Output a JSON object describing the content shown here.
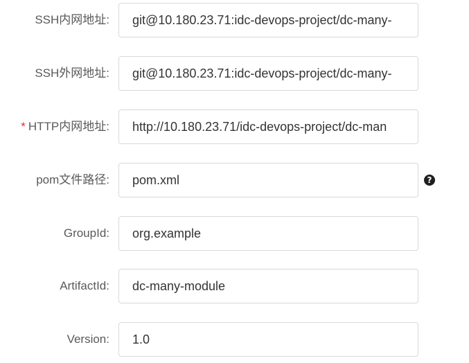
{
  "form": {
    "fields": [
      {
        "label": "SSH内网地址:",
        "value": "git@10.180.23.71:idc-devops-project/dc-many-",
        "required": false
      },
      {
        "label": "SSH外网地址:",
        "value": "git@10.180.23.71:idc-devops-project/dc-many-",
        "required": false
      },
      {
        "label": "HTTP内网地址:",
        "value": "http://10.180.23.71/idc-devops-project/dc-man",
        "required": true,
        "required_mark": "*"
      },
      {
        "label": "pom文件路径:",
        "value": "pom.xml",
        "required": false,
        "help_icon": "question-circle-icon",
        "help_glyph": "?"
      },
      {
        "label": "GroupId:",
        "value": "org.example",
        "required": false
      },
      {
        "label": "ArtifactId:",
        "value": "dc-many-module",
        "required": false
      },
      {
        "label": "Version:",
        "value": "1.0",
        "required": false
      }
    ]
  },
  "colors": {
    "label": "#595959",
    "input_text": "#333333",
    "input_border": "#d9d9d9",
    "required": "#f5222d",
    "help_icon": "#1f1f1f"
  }
}
